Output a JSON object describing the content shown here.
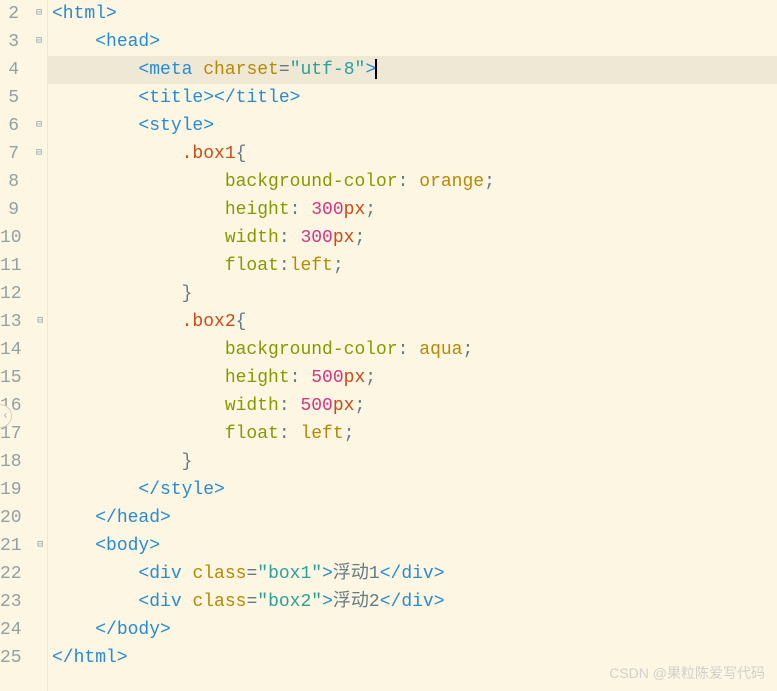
{
  "lines": [
    {
      "num": "2",
      "fold": "⊟",
      "indent": 0,
      "segs": [
        {
          "c": "tag",
          "t": "<html>"
        }
      ]
    },
    {
      "num": "3",
      "fold": "⊟",
      "indent": 1,
      "segs": [
        {
          "c": "tag",
          "t": "<head>"
        }
      ]
    },
    {
      "num": "4",
      "fold": "",
      "indent": 2,
      "active": true,
      "cursor": true,
      "segs": [
        {
          "c": "tag",
          "t": "<meta"
        },
        {
          "c": "txt",
          "t": " "
        },
        {
          "c": "attr",
          "t": "charset"
        },
        {
          "c": "txt",
          "t": "="
        },
        {
          "c": "str",
          "t": "\"utf-8\""
        },
        {
          "c": "tag",
          "t": ">"
        }
      ]
    },
    {
      "num": "5",
      "fold": "",
      "indent": 2,
      "segs": [
        {
          "c": "tag",
          "t": "<title></title>"
        }
      ]
    },
    {
      "num": "6",
      "fold": "⊟",
      "indent": 2,
      "segs": [
        {
          "c": "tag",
          "t": "<style>"
        }
      ]
    },
    {
      "num": "7",
      "fold": "⊟",
      "indent": 3,
      "segs": [
        {
          "c": "sel",
          "t": ".box1"
        },
        {
          "c": "txt",
          "t": "{"
        }
      ]
    },
    {
      "num": "8",
      "fold": "",
      "indent": 4,
      "segs": [
        {
          "c": "prop",
          "t": "background-color"
        },
        {
          "c": "txt",
          "t": ": "
        },
        {
          "c": "val",
          "t": "orange"
        },
        {
          "c": "txt",
          "t": ";"
        }
      ]
    },
    {
      "num": "9",
      "fold": "",
      "indent": 4,
      "segs": [
        {
          "c": "prop",
          "t": "height"
        },
        {
          "c": "txt",
          "t": ": "
        },
        {
          "c": "num",
          "t": "300"
        },
        {
          "c": "unit",
          "t": "px"
        },
        {
          "c": "txt",
          "t": ";"
        }
      ]
    },
    {
      "num": "10",
      "fold": "",
      "indent": 4,
      "segs": [
        {
          "c": "prop",
          "t": "width"
        },
        {
          "c": "txt",
          "t": ": "
        },
        {
          "c": "num",
          "t": "300"
        },
        {
          "c": "unit",
          "t": "px"
        },
        {
          "c": "txt",
          "t": ";"
        }
      ]
    },
    {
      "num": "11",
      "fold": "",
      "indent": 4,
      "segs": [
        {
          "c": "prop",
          "t": "float"
        },
        {
          "c": "txt",
          "t": ":"
        },
        {
          "c": "val",
          "t": "left"
        },
        {
          "c": "txt",
          "t": ";"
        }
      ]
    },
    {
      "num": "12",
      "fold": "",
      "indent": 3,
      "segs": [
        {
          "c": "txt",
          "t": "}"
        }
      ]
    },
    {
      "num": "13",
      "fold": "⊟",
      "indent": 3,
      "segs": [
        {
          "c": "sel",
          "t": ".box2"
        },
        {
          "c": "txt",
          "t": "{"
        }
      ]
    },
    {
      "num": "14",
      "fold": "",
      "indent": 4,
      "segs": [
        {
          "c": "prop",
          "t": "background-color"
        },
        {
          "c": "txt",
          "t": ": "
        },
        {
          "c": "val",
          "t": "aqua"
        },
        {
          "c": "txt",
          "t": ";"
        }
      ]
    },
    {
      "num": "15",
      "fold": "",
      "indent": 4,
      "segs": [
        {
          "c": "prop",
          "t": "height"
        },
        {
          "c": "txt",
          "t": ": "
        },
        {
          "c": "num",
          "t": "500"
        },
        {
          "c": "unit",
          "t": "px"
        },
        {
          "c": "txt",
          "t": ";"
        }
      ]
    },
    {
      "num": "16",
      "fold": "",
      "indent": 4,
      "segs": [
        {
          "c": "prop",
          "t": "width"
        },
        {
          "c": "txt",
          "t": ": "
        },
        {
          "c": "num",
          "t": "500"
        },
        {
          "c": "unit",
          "t": "px"
        },
        {
          "c": "txt",
          "t": ";"
        }
      ]
    },
    {
      "num": "17",
      "fold": "",
      "indent": 4,
      "segs": [
        {
          "c": "prop",
          "t": "float"
        },
        {
          "c": "txt",
          "t": ": "
        },
        {
          "c": "val",
          "t": "left"
        },
        {
          "c": "txt",
          "t": ";"
        }
      ]
    },
    {
      "num": "18",
      "fold": "",
      "indent": 3,
      "segs": [
        {
          "c": "txt",
          "t": "}"
        }
      ]
    },
    {
      "num": "19",
      "fold": "",
      "indent": 2,
      "segs": [
        {
          "c": "tag",
          "t": "</style>"
        }
      ]
    },
    {
      "num": "20",
      "fold": "",
      "indent": 1,
      "segs": [
        {
          "c": "tag",
          "t": "</head>"
        }
      ]
    },
    {
      "num": "21",
      "fold": "⊟",
      "indent": 1,
      "segs": [
        {
          "c": "tag",
          "t": "<body>"
        }
      ]
    },
    {
      "num": "22",
      "fold": "",
      "indent": 2,
      "segs": [
        {
          "c": "tag",
          "t": "<div"
        },
        {
          "c": "txt",
          "t": " "
        },
        {
          "c": "attr",
          "t": "class"
        },
        {
          "c": "txt",
          "t": "="
        },
        {
          "c": "str",
          "t": "\"box1\""
        },
        {
          "c": "tag",
          "t": ">"
        },
        {
          "c": "txt",
          "t": "浮动1"
        },
        {
          "c": "tag",
          "t": "</div>"
        }
      ]
    },
    {
      "num": "23",
      "fold": "",
      "indent": 2,
      "segs": [
        {
          "c": "tag",
          "t": "<div"
        },
        {
          "c": "txt",
          "t": " "
        },
        {
          "c": "attr",
          "t": "class"
        },
        {
          "c": "txt",
          "t": "="
        },
        {
          "c": "str",
          "t": "\"box2\""
        },
        {
          "c": "tag",
          "t": ">"
        },
        {
          "c": "txt",
          "t": "浮动2"
        },
        {
          "c": "tag",
          "t": "</div>"
        }
      ]
    },
    {
      "num": "24",
      "fold": "",
      "indent": 1,
      "segs": [
        {
          "c": "tag",
          "t": "</body>"
        }
      ]
    },
    {
      "num": "25",
      "fold": "",
      "indent": 0,
      "segs": [
        {
          "c": "tag",
          "t": "</html>"
        }
      ]
    }
  ],
  "watermark": "CSDN @果粒陈爱写代码",
  "sideIndicator": "‹"
}
